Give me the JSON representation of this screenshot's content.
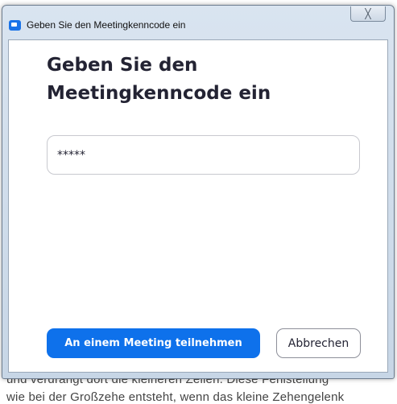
{
  "window": {
    "title": "Geben Sie den Meetingkenncode ein",
    "close_label": "╳"
  },
  "dialog": {
    "heading": "Geben Sie den Meetingkenncode ein",
    "passcode_value": "*****",
    "join_label": "An einem Meeting teilnehmen",
    "cancel_label": "Abbrechen"
  },
  "background": {
    "line_1": "und verdrängt dort die kleineren Zellen. Diese Fehlstellung",
    "line_2": "wie bei der Großzehe entsteht, wenn das kleine Zehengelenk"
  },
  "colors": {
    "primary_button": "#0e71eb",
    "heading_text": "#232333",
    "app_icon": "#1a73e8"
  }
}
